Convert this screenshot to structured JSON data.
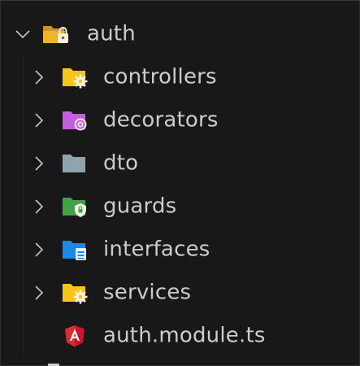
{
  "explorer": {
    "root": {
      "label": "auth",
      "expanded": true,
      "icon": "folder-open-lock-icon",
      "icon_color": "#e8b440"
    },
    "items": [
      {
        "label": "controllers",
        "type": "folder",
        "icon": "folder-gear-icon",
        "icon_color": "#f5c518"
      },
      {
        "label": "decorators",
        "type": "folder",
        "icon": "folder-at-icon",
        "icon_color": "#c160d8"
      },
      {
        "label": "dto",
        "type": "folder",
        "icon": "folder-plain-icon",
        "icon_color": "#90a4ae"
      },
      {
        "label": "guards",
        "type": "folder",
        "icon": "folder-shield-icon",
        "icon_color": "#43a047"
      },
      {
        "label": "interfaces",
        "type": "folder",
        "icon": "folder-interface-icon",
        "icon_color": "#1e88e5"
      },
      {
        "label": "services",
        "type": "folder",
        "icon": "folder-gear-icon",
        "icon_color": "#f5c518"
      },
      {
        "label": "auth.module.ts",
        "type": "file",
        "icon": "angular-icon",
        "icon_color": "#dd2c2c"
      }
    ]
  }
}
